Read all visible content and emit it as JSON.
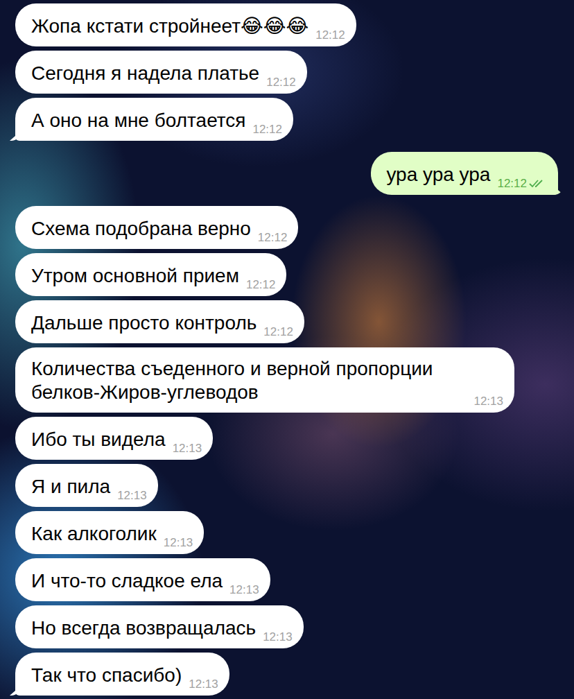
{
  "chat": {
    "messages": [
      {
        "text": "Жопа кстати стройнеет😂😂😂",
        "time": "12:12",
        "direction": "in"
      },
      {
        "text": "Сегодня я надела платье",
        "time": "12:12",
        "direction": "in"
      },
      {
        "text": "А оно на мне болтается",
        "time": "12:12",
        "direction": "in"
      },
      {
        "text": "ура ура ура",
        "time": "12:12",
        "direction": "out",
        "read": true
      },
      {
        "text": "Схема подобрана верно",
        "time": "12:12",
        "direction": "in"
      },
      {
        "text": "Утром основной прием",
        "time": "12:12",
        "direction": "in"
      },
      {
        "text": "Дальше просто контроль",
        "time": "12:12",
        "direction": "in"
      },
      {
        "text": "Количества съеденного и верной пропорции белков-Жиров-углеводов",
        "time": "12:13",
        "direction": "in"
      },
      {
        "text": "Ибо ты видела",
        "time": "12:13",
        "direction": "in"
      },
      {
        "text": "Я и пила",
        "time": "12:13",
        "direction": "in"
      },
      {
        "text": "Как алкоголик",
        "time": "12:13",
        "direction": "in"
      },
      {
        "text": "И что-то сладкое ела",
        "time": "12:13",
        "direction": "in"
      },
      {
        "text": "Но всегда возвращалась",
        "time": "12:13",
        "direction": "in"
      },
      {
        "text": "Так что спасибо)",
        "time": "12:13",
        "direction": "in"
      }
    ]
  }
}
